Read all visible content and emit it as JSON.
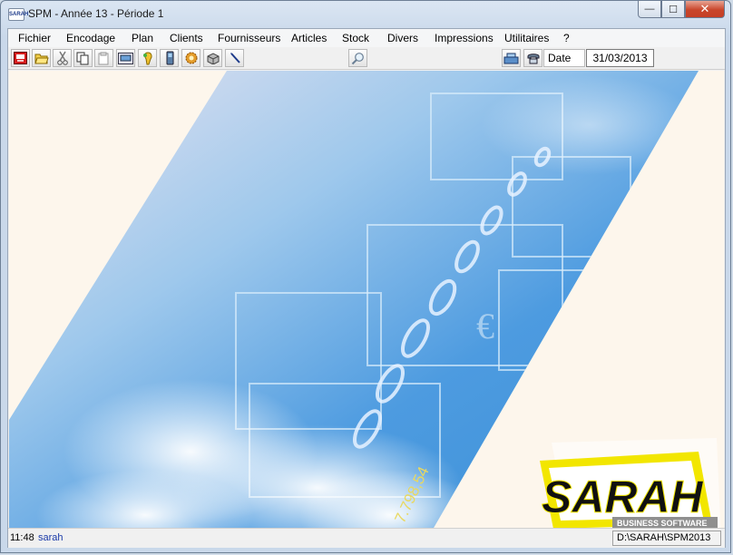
{
  "window": {
    "title": "SPM - Année 13 - Période 1",
    "icon": "sarah-app-icon"
  },
  "window_buttons": {
    "minimize": "—",
    "maximize": "☐",
    "close": "✕"
  },
  "menu": [
    "Fichier",
    "Encodage",
    "Plan",
    "Clients",
    "Fournisseurs",
    "Articles",
    "Stock",
    "Divers",
    "Impressions",
    "Utilitaires",
    "?"
  ],
  "toolbar": {
    "buttons": [
      "exit-icon",
      "open-folder-icon",
      "cut-icon",
      "copy-icon",
      "paste-icon",
      "mail-icon",
      "dummy-icon",
      "mobile-icon",
      "settings-gear-icon",
      "box-icon",
      "pen-icon",
      "search-icon",
      "cash-register-icon",
      "phone-icon"
    ]
  },
  "date": {
    "label": "Date",
    "value": "31/03/2013"
  },
  "splash": {
    "logo_main": "SARAH",
    "logo_sub": "BUSINESS SOFTWARE",
    "watermark_number": "7.798,54",
    "watermark_symbol": "€"
  },
  "status": {
    "time": "11:48",
    "user": "sarah",
    "path": "D:\\SARAH\\SPM2013"
  },
  "colors": {
    "accent_blue": "#3a8fd6",
    "logo_yellow": "#f2e600",
    "logo_text": "#111111",
    "close_red": "#c9462b"
  }
}
